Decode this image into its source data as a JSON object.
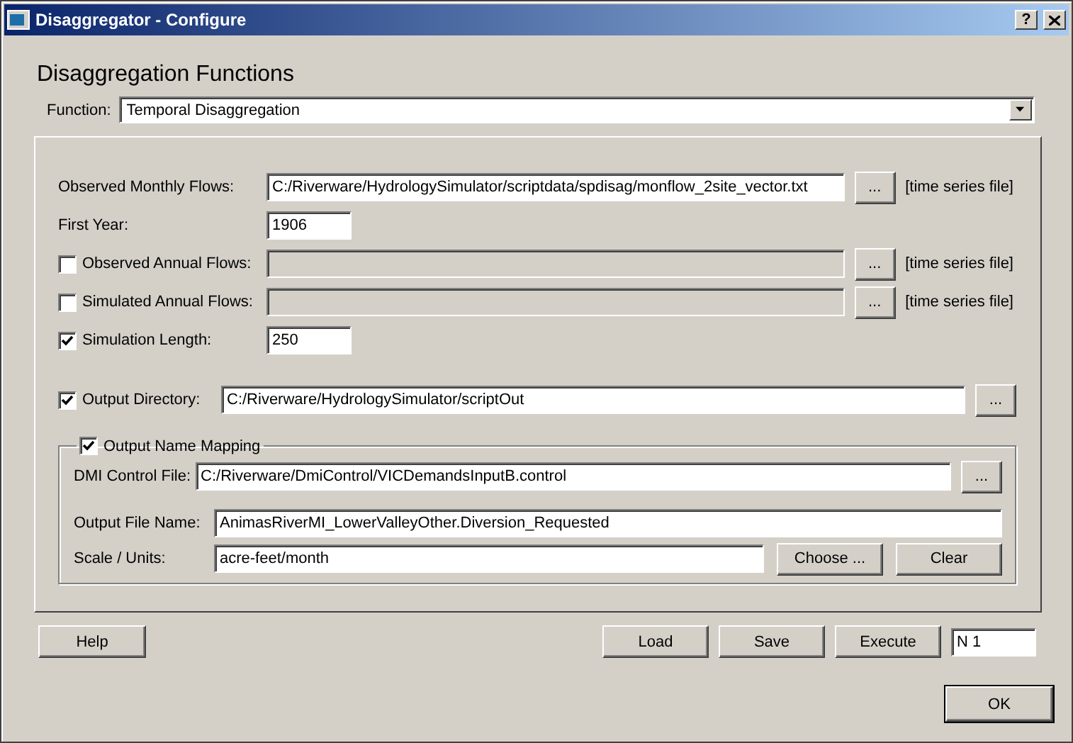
{
  "window": {
    "title": "Disaggregator - Configure",
    "help_button": "?"
  },
  "heading": "Disaggregation Functions",
  "function": {
    "label": "Function:",
    "value": "Temporal Disaggregation"
  },
  "inputs": [
    {
      "kind": "file",
      "label": "Observed Monthly Flows:",
      "value": "C:/Riverware/HydrologySimulator/scriptdata/spdisag/monflow_2site_vector.txt",
      "browse": "...",
      "suffix": "[time series file]"
    },
    {
      "kind": "number",
      "label": "First Year:",
      "value": "1906"
    },
    {
      "kind": "file",
      "label": "Observed Annual Flows:",
      "checkbox": {
        "checked": false
      },
      "browse": "...",
      "suffix": "[time series file]"
    },
    {
      "kind": "file",
      "label": "Simulated Annual Flows:",
      "checkbox": {
        "checked": false
      },
      "browse": "...",
      "suffix": "[time series file]"
    },
    {
      "kind": "number",
      "label": "Simulation Length:",
      "checkbox": {
        "checked": true
      },
      "value": "250"
    }
  ],
  "output_directory": {
    "label": "Output Directory:",
    "checked": true,
    "value": "C:/Riverware/HydrologySimulator/scriptOut",
    "browse": "..."
  },
  "output_name_mapping": {
    "label": "Output Name Mapping",
    "checked": true,
    "dmi_control_file": {
      "label": "DMI Control File:",
      "value": "C:/Riverware/DmiControl/VICDemandsInputB.control",
      "browse": "..."
    },
    "output_file_name": {
      "label": "Output File Name:",
      "value": "AnimasRiverMI_LowerValleyOther.Diversion_Requested"
    },
    "scale_units": {
      "label": "Scale / Units:",
      "value": "acre-feet/month",
      "buttons": [
        "Choose ...",
        "Clear"
      ]
    }
  },
  "footer": {
    "help": "Help",
    "actions": [
      "Load",
      "Save",
      "Execute"
    ],
    "run_field": "N 1",
    "ok": "OK"
  }
}
